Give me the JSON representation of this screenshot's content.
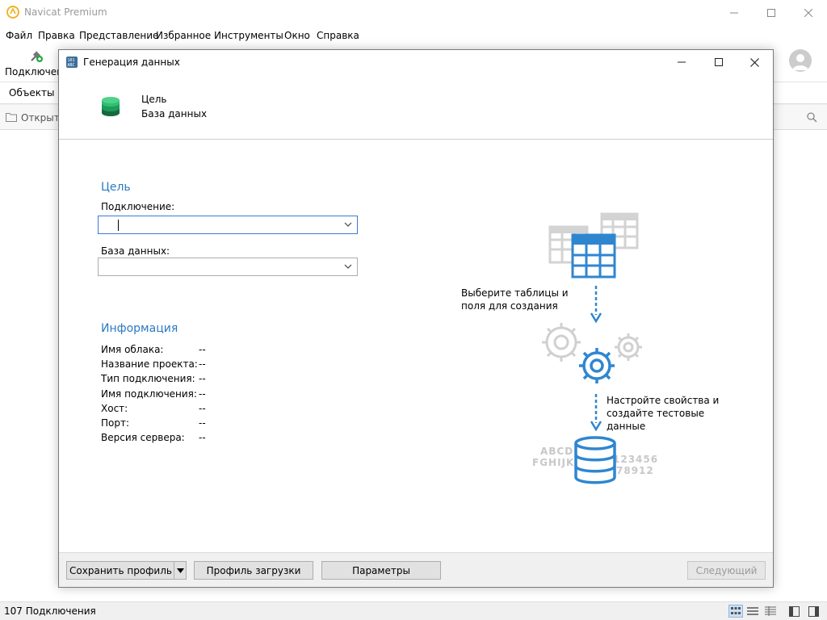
{
  "app": {
    "title": "Navicat Premium",
    "menu": [
      "Файл",
      "Правка",
      "Представление",
      "Избранное",
      "Инструменты",
      "Окно",
      "Справка"
    ],
    "toolbar_connection_label": "Подключение",
    "objects_tab": "Объекты",
    "open_label": "Открыть",
    "status_text": "107 Подключения"
  },
  "dialog": {
    "title": "Генерация данных",
    "header": {
      "line1": "Цель",
      "line2": "База данных"
    },
    "target": {
      "section_title": "Цель",
      "connection_label": "Подключение:",
      "connection_value": "",
      "database_label": "База данных:",
      "database_value": ""
    },
    "info": {
      "section_title": "Информация",
      "rows": [
        {
          "label": "Имя облака:",
          "value": "--"
        },
        {
          "label": "Название проекта:",
          "value": "--"
        },
        {
          "label": "Тип подключения:",
          "value": "--"
        },
        {
          "label": "Имя подключения:",
          "value": "--"
        },
        {
          "label": "Хост:",
          "value": "--"
        },
        {
          "label": "Порт:",
          "value": "--"
        },
        {
          "label": "Версия сервера:",
          "value": "--"
        }
      ]
    },
    "diagram": {
      "step1": "Выберите таблицы и поля для создания",
      "step2": "Настройте свойства и создайте тестовые данные",
      "sample_letters_1": "ABCDE",
      "sample_letters_2": "FGHIJKL",
      "sample_digits_1": "123456",
      "sample_digits_2": "78912"
    },
    "footer": {
      "save_profile": "Сохранить профиль",
      "load_profile": "Профиль загрузки",
      "parameters": "Параметры",
      "next": "Следующий"
    }
  },
  "colors": {
    "accent": "#2b79c2",
    "diagram_blue": "#2f86d0",
    "diagram_gray": "#d0d0d0",
    "db_green": "#1e9b5a"
  }
}
